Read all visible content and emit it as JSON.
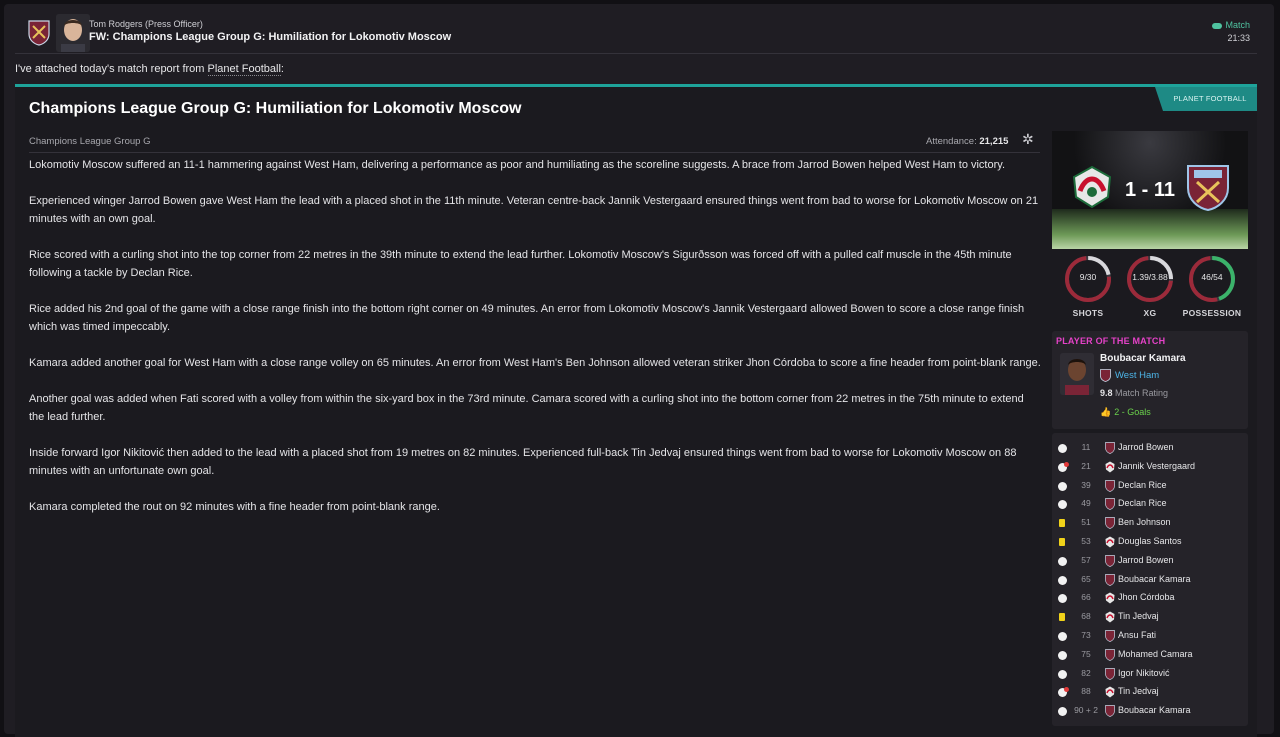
{
  "header": {
    "sender": "Tom Rodgers  (Press Officer)",
    "subject": "FW: Champions League Group G: Humiliation for Lokomotiv Moscow",
    "match_link": "Match",
    "time": "21:33"
  },
  "intro": {
    "prefix": "I've attached today's match report from ",
    "source_link": "Planet Football",
    "suffix": ":"
  },
  "article": {
    "tag": "PLANET FOOTBALL",
    "title": "Champions League Group G: Humiliation for Lokomotiv Moscow",
    "competition": "Champions League Group G",
    "attendance_label": "Attendance:",
    "attendance_value": "21,215",
    "paragraphs": [
      "Lokomotiv Moscow suffered an 11-1 hammering against West Ham, delivering a performance as poor and humiliating as the scoreline suggests. A brace from Jarrod Bowen helped West Ham to victory.",
      "Experienced winger Jarrod Bowen gave West Ham the lead with a placed shot in the 11th minute. Veteran centre-back Jannik Vestergaard ensured things went from bad to worse for Lokomotiv Moscow on 21 minutes with an own goal.",
      "Rice scored with a curling shot into the top corner from 22 metres in the 39th minute to extend the lead further. Lokomotiv Moscow's Sigurðsson was forced off with a pulled calf muscle in the 45th minute following a tackle by Declan Rice.",
      "Rice added his 2nd goal of the game with a close range finish into the bottom right corner on 49 minutes. An error from Lokomotiv Moscow's Jannik Vestergaard allowed Bowen to score a close range finish which was timed impeccably.",
      "Kamara added another goal for West Ham with a close range volley on 65 minutes. An error from West Ham's Ben Johnson allowed veteran striker Jhon Córdoba to score a fine header from point-blank range.",
      "Another goal was added when Fati scored with a volley from within the six-yard box in the 73rd minute. Camara scored with a curling shot into the bottom corner from 22 metres in the 75th minute to extend the lead further.",
      "Inside forward Igor Nikitović then added to the lead with a placed shot from 19 metres on 82 minutes. Experienced full-back Tin Jedvaj ensured things went from bad to worse for Lokomotiv Moscow on 88 minutes with an unfortunate own goal.",
      "Kamara completed the rout on 92 minutes with a fine header from point-blank range."
    ]
  },
  "scoreboard": {
    "score": "1 - 11",
    "home_team": "Lokomotiv Moscow",
    "away_team": "West Ham"
  },
  "stats": [
    {
      "label": "SHOTS",
      "value": "9/30",
      "home": 9,
      "away": 30,
      "color_home": "#d8d8dc",
      "color_away": "#9c2a3a"
    },
    {
      "label": "XG",
      "value": "1.39/3.88",
      "home": 1.39,
      "away": 3.88,
      "color_home": "#d8d8dc",
      "color_away": "#9c2a3a"
    },
    {
      "label": "POSSESSION",
      "value": "46/54",
      "home": 46,
      "away": 54,
      "color_home": "#3bb26a",
      "color_away": "#9c2a3a"
    }
  ],
  "potm": {
    "heading": "PLAYER OF THE MATCH",
    "name": "Boubacar Kamara",
    "club": "West Ham",
    "rating": "9.8",
    "rating_label": "Match Rating",
    "goals": "2 - Goals"
  },
  "events": [
    {
      "type": "goal",
      "minute": "11",
      "team": "westham",
      "player": "Jarrod Bowen"
    },
    {
      "type": "own-goal",
      "minute": "21",
      "team": "loko",
      "player": "Jannik Vestergaard"
    },
    {
      "type": "goal",
      "minute": "39",
      "team": "westham",
      "player": "Declan Rice"
    },
    {
      "type": "goal",
      "minute": "49",
      "team": "westham",
      "player": "Declan Rice"
    },
    {
      "type": "yellow",
      "minute": "51",
      "team": "westham",
      "player": "Ben Johnson"
    },
    {
      "type": "yellow",
      "minute": "53",
      "team": "loko",
      "player": "Douglas Santos"
    },
    {
      "type": "goal",
      "minute": "57",
      "team": "westham",
      "player": "Jarrod Bowen"
    },
    {
      "type": "goal",
      "minute": "65",
      "team": "westham",
      "player": "Boubacar Kamara"
    },
    {
      "type": "goal",
      "minute": "66",
      "team": "loko",
      "player": "Jhon Córdoba"
    },
    {
      "type": "yellow",
      "minute": "68",
      "team": "loko",
      "player": "Tin Jedvaj"
    },
    {
      "type": "goal",
      "minute": "73",
      "team": "westham",
      "player": "Ansu Fati"
    },
    {
      "type": "goal",
      "minute": "75",
      "team": "westham",
      "player": "Mohamed Camara"
    },
    {
      "type": "goal",
      "minute": "82",
      "team": "westham",
      "player": "Igor Nikitović"
    },
    {
      "type": "own-goal",
      "minute": "88",
      "team": "loko",
      "player": "Tin Jedvaj"
    },
    {
      "type": "goal",
      "minute": "90 + 2",
      "team": "westham",
      "player": "Boubacar Kamara"
    }
  ]
}
